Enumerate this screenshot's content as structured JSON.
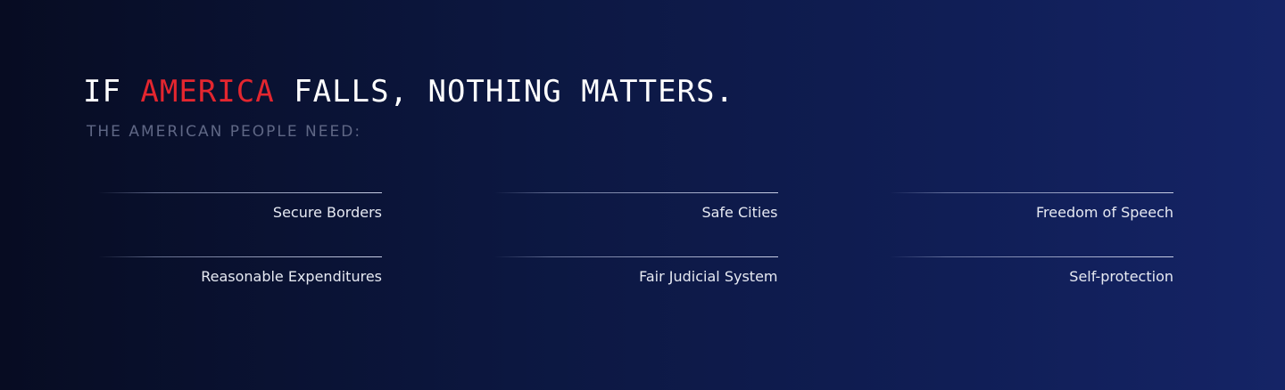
{
  "headline": {
    "prefix": "IF ",
    "accent": "AMERICA",
    "suffix": " FALLS, NOTHING MATTERS."
  },
  "subheadline": "THE AMERICAN PEOPLE NEED:",
  "needs": [
    "Secure Borders",
    "Safe Cities",
    "Freedom of Speech",
    "Reasonable Expenditures",
    "Fair Judicial System",
    "Self-protection"
  ],
  "colors": {
    "accent": "#e3262f",
    "background_start": "#070c22",
    "background_end": "#152466",
    "text": "#ffffff",
    "muted": "#5f6785"
  }
}
